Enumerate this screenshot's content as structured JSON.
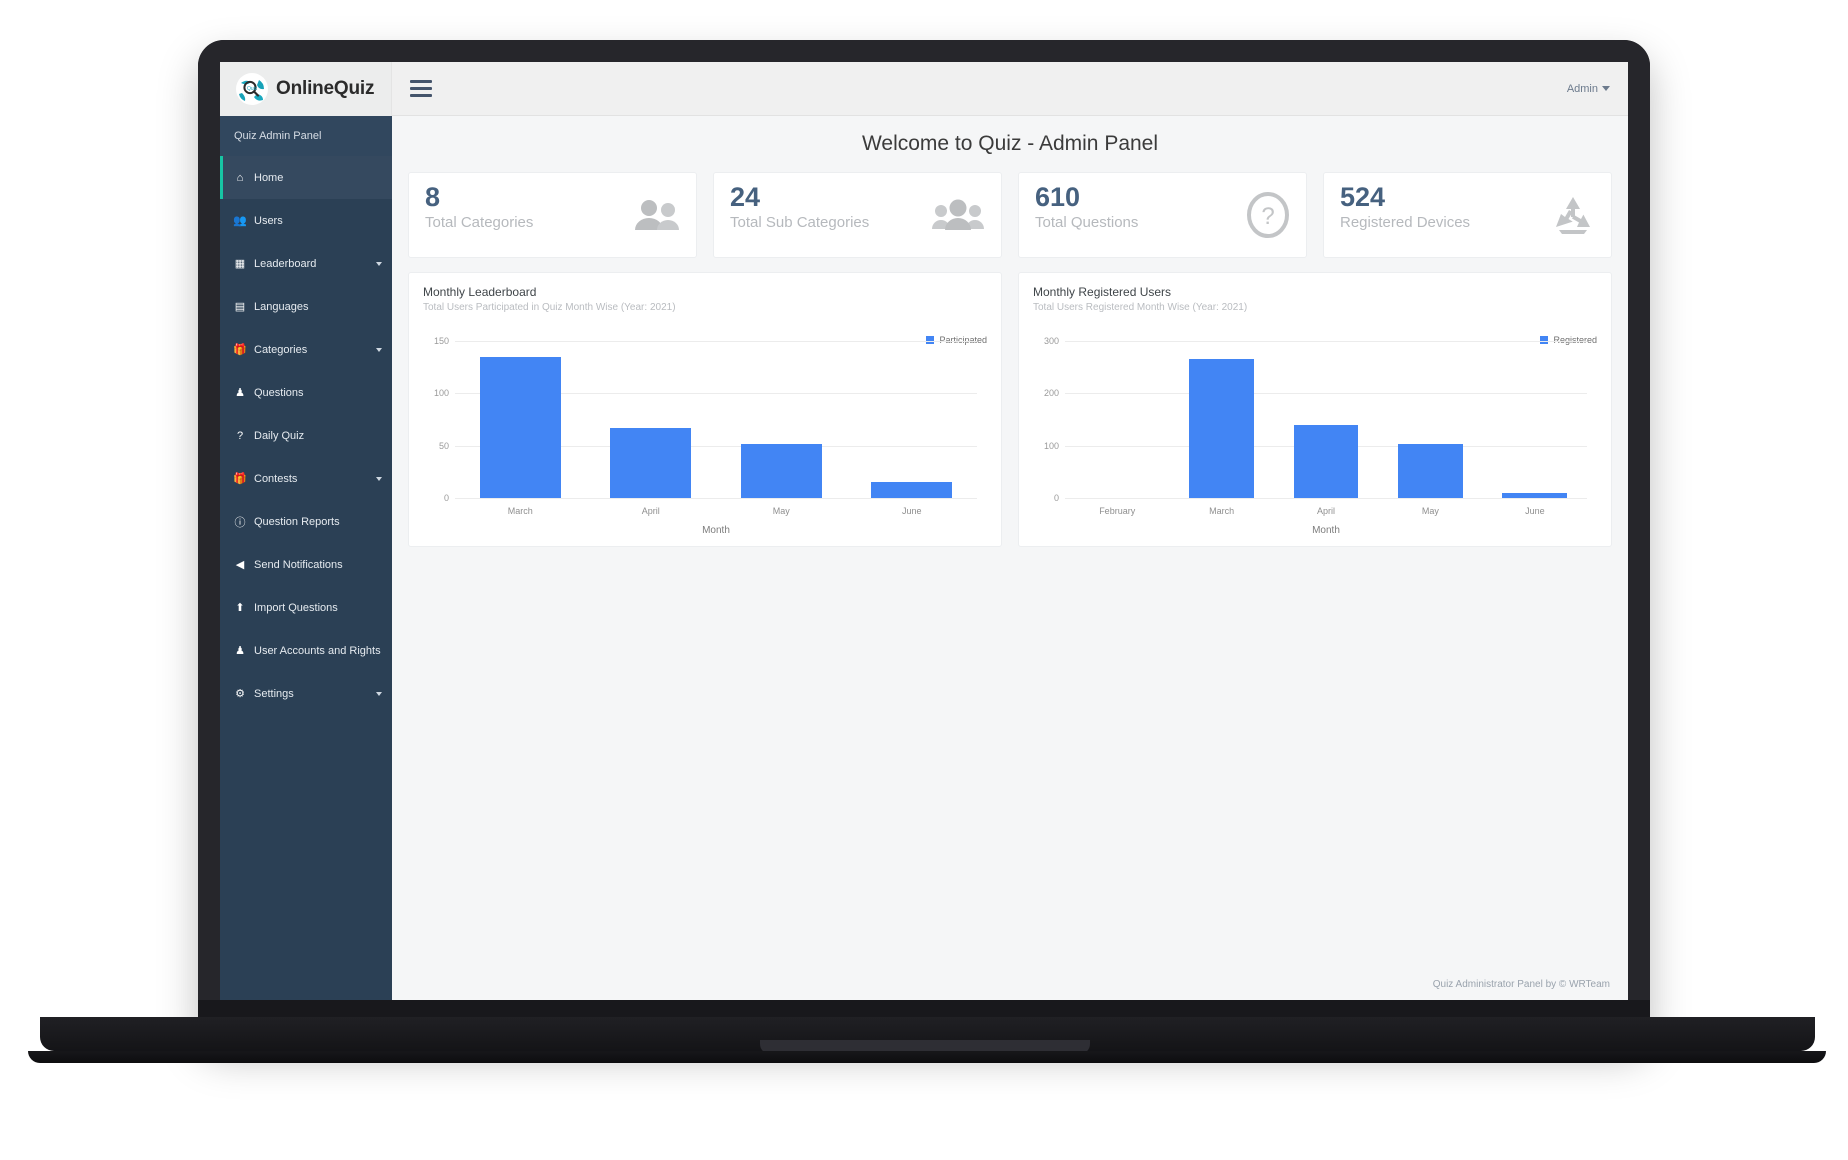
{
  "navbar": {
    "brand_name": "OnlineQuiz",
    "brand_logo_icon": "globe-search-logo-icon",
    "menu_toggle_icon": "hamburger-menu-icon",
    "account_label": "Admin",
    "account_caret_icon": "chevron-down-icon"
  },
  "sidebar": {
    "heading": "Quiz Admin Panel",
    "items": [
      {
        "label": "Home",
        "icon": "home-icon",
        "active": true,
        "has_caret": false
      },
      {
        "label": "Users",
        "icon": "users-icon",
        "active": false,
        "has_caret": false
      },
      {
        "label": "Leaderboard",
        "icon": "grid-icon",
        "active": false,
        "has_caret": true
      },
      {
        "label": "Languages",
        "icon": "language-icon",
        "active": false,
        "has_caret": false
      },
      {
        "label": "Categories",
        "icon": "gift-icon",
        "active": false,
        "has_caret": true
      },
      {
        "label": "Questions",
        "icon": "trophy-icon",
        "active": false,
        "has_caret": false
      },
      {
        "label": "Daily Quiz",
        "icon": "question-mark-icon",
        "active": false,
        "has_caret": false
      },
      {
        "label": "Contests",
        "icon": "gift-icon",
        "active": false,
        "has_caret": true
      },
      {
        "label": "Question Reports",
        "icon": "clock-icon",
        "active": false,
        "has_caret": false
      },
      {
        "label": "Send Notifications",
        "icon": "megaphone-icon",
        "active": false,
        "has_caret": false
      },
      {
        "label": "Import Questions",
        "icon": "upload-icon",
        "active": false,
        "has_caret": false
      },
      {
        "label": "User Accounts and Rights",
        "icon": "user-icon",
        "active": false,
        "has_caret": false
      },
      {
        "label": "Settings",
        "icon": "gear-icon",
        "active": false,
        "has_caret": true
      }
    ]
  },
  "main": {
    "page_title": "Welcome to Quiz - Admin Panel",
    "stat_cards": [
      {
        "value": "8",
        "label": "Total Categories",
        "icon": "two-people-icon"
      },
      {
        "value": "24",
        "label": "Total Sub Categories",
        "icon": "group-people-icon"
      },
      {
        "value": "610",
        "label": "Total Questions",
        "icon": "question-circle-icon"
      },
      {
        "value": "524",
        "label": "Registered Devices",
        "icon": "recycle-icon"
      }
    ],
    "footer_note": "Quiz Administrator Panel by © WRTeam"
  },
  "colors": {
    "sidebar_bg": "#2b4055",
    "accent_teal": "#17c5a4",
    "bar_blue": "#4285f4",
    "stat_number": "#46617f"
  },
  "chart_data": [
    {
      "type": "bar",
      "title": "Monthly Leaderboard",
      "subtitle": "Total Users Participated in Quiz Month Wise (Year: 2021)",
      "categories": [
        "March",
        "April",
        "May",
        "June"
      ],
      "values": [
        135,
        67,
        52,
        15
      ],
      "series": [
        {
          "name": "Participated",
          "values": [
            135,
            67,
            52,
            15
          ]
        }
      ],
      "xlabel": "Month",
      "ylabel": "",
      "ylim": [
        0,
        150
      ],
      "yticks": [
        0,
        50,
        100,
        150
      ],
      "legend": [
        "Participated"
      ],
      "legend_position": "top-right",
      "grid": true,
      "color": "#4285f4"
    },
    {
      "type": "bar",
      "title": "Monthly Registered Users",
      "subtitle": "Total Users Registered Month Wise (Year: 2021)",
      "categories": [
        "February",
        "March",
        "April",
        "May",
        "June"
      ],
      "values": [
        0,
        265,
        140,
        103,
        10
      ],
      "series": [
        {
          "name": "Registered",
          "values": [
            0,
            265,
            140,
            103,
            10
          ]
        }
      ],
      "xlabel": "Month",
      "ylabel": "",
      "ylim": [
        0,
        300
      ],
      "yticks": [
        0,
        100,
        200,
        300
      ],
      "legend": [
        "Registered"
      ],
      "legend_position": "top-right",
      "grid": true,
      "color": "#4285f4"
    }
  ]
}
